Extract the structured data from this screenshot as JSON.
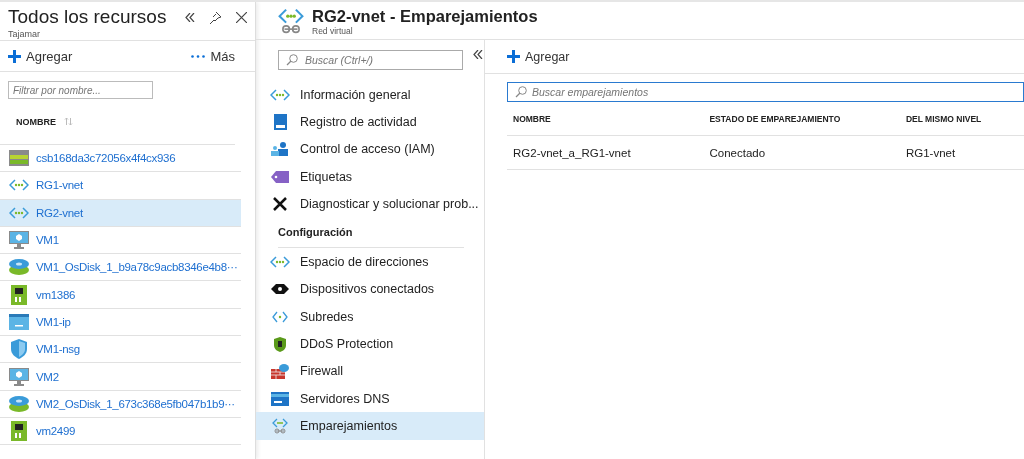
{
  "resources_panel": {
    "title": "Todos los recursos",
    "subtitle": "Tajamar",
    "toolbar": {
      "add": "Agregar",
      "more": "Más"
    },
    "filter": {
      "placeholder": "Filtrar por nombre..."
    },
    "column": "NOMBRE",
    "items": [
      {
        "name": "csb168da3c72056x4f4cx936",
        "kind": "storage",
        "selected": false
      },
      {
        "name": "RG1-vnet",
        "kind": "vnet",
        "selected": false
      },
      {
        "name": "RG2-vnet",
        "kind": "vnet",
        "selected": true
      },
      {
        "name": "VM1",
        "kind": "vm",
        "selected": false
      },
      {
        "name": "VM1_OsDisk_1_b9a78c9acb8346e4b8···",
        "kind": "disk",
        "selected": false
      },
      {
        "name": "vm1386",
        "kind": "nic",
        "selected": false
      },
      {
        "name": "VM1-ip",
        "kind": "ip",
        "selected": false
      },
      {
        "name": "VM1-nsg",
        "kind": "nsg",
        "selected": false
      },
      {
        "name": "VM2",
        "kind": "vm",
        "selected": false
      },
      {
        "name": "VM2_OsDisk_1_673c368e5fb047b1b9···",
        "kind": "disk",
        "selected": false
      },
      {
        "name": "vm2499",
        "kind": "nic",
        "selected": false
      }
    ]
  },
  "blade": {
    "title": "RG2-vnet - Emparejamientos",
    "subtitle": "Red virtual",
    "menu": {
      "search_placeholder": "Buscar (Ctrl+/)",
      "items": [
        {
          "kind": "item",
          "label": "Información general",
          "selected": false
        },
        {
          "kind": "item",
          "label": "Registro de actividad",
          "selected": false
        },
        {
          "kind": "item",
          "label": "Control de acceso (IAM)",
          "selected": false
        },
        {
          "kind": "item",
          "label": "Etiquetas",
          "selected": false
        },
        {
          "kind": "item",
          "label": "Diagnosticar y solucionar prob...",
          "selected": false
        },
        {
          "kind": "heading",
          "label": "Configuración"
        },
        {
          "kind": "item",
          "label": "Espacio de direcciones",
          "selected": false
        },
        {
          "kind": "item",
          "label": "Dispositivos conectados",
          "selected": false
        },
        {
          "kind": "item",
          "label": "Subredes",
          "selected": false
        },
        {
          "kind": "item",
          "label": "DDoS Protection",
          "selected": false
        },
        {
          "kind": "item",
          "label": "Firewall",
          "selected": false
        },
        {
          "kind": "item",
          "label": "Servidores DNS",
          "selected": false
        },
        {
          "kind": "item",
          "label": "Emparejamientos",
          "selected": true
        }
      ]
    },
    "content": {
      "add": "Agregar",
      "search_placeholder": "Buscar emparejamientos",
      "columns": [
        "NOMBRE",
        "ESTADO DE EMPAREJAMIENTO",
        "DEL MISMO NIVEL"
      ],
      "rows": [
        [
          "RG2-vnet_a_RG1-vnet",
          "Conectado",
          "RG1-vnet"
        ]
      ]
    }
  }
}
